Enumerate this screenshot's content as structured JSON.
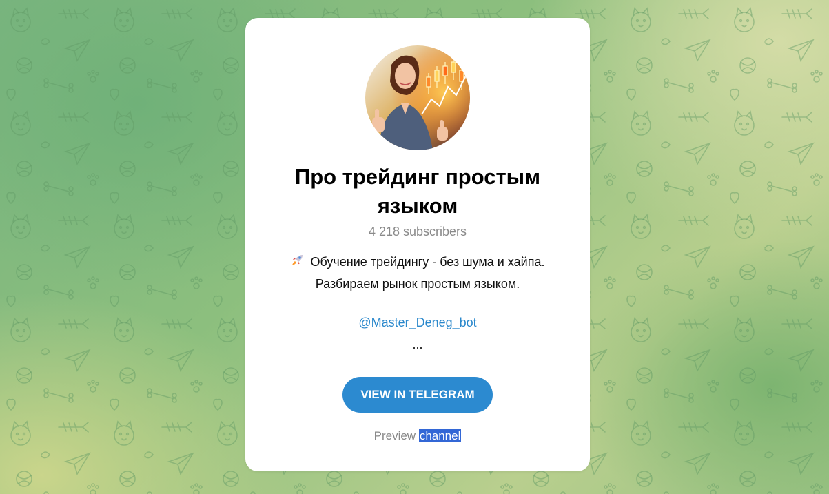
{
  "channel": {
    "title": "Про трейдинг простым языком",
    "subscribers": "4 218 subscribers",
    "description_line1": "Обучение трейдингу - без шума и хайпа.",
    "description_line2": "Разбираем рынок простым языком.",
    "link": "@Master_Deneg_bot",
    "ellipsis": "..."
  },
  "button": {
    "label": "VIEW IN TELEGRAM"
  },
  "preview": {
    "prefix": "Preview",
    "highlighted": "channel"
  },
  "icons": {
    "rocket": "rocket-icon",
    "avatar": "channel-avatar"
  },
  "colors": {
    "accent": "#2c8ad0",
    "link": "#2a88cc",
    "selection": "#3367d6"
  }
}
